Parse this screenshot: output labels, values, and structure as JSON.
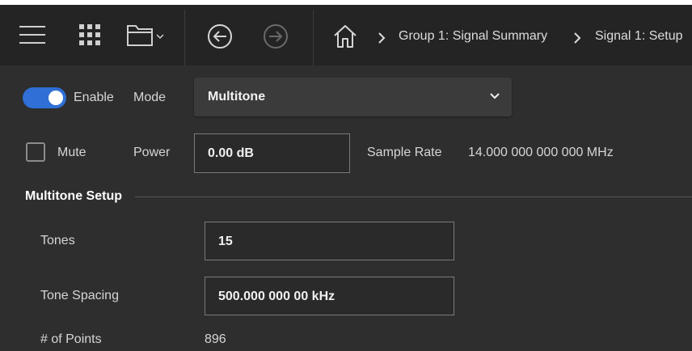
{
  "toolbar": {
    "icons": [
      "menu-icon",
      "apps-grid-icon",
      "folder-icon",
      "back-icon",
      "forward-icon",
      "home-icon"
    ],
    "breadcrumb": [
      {
        "label": "Group 1: Signal Summary"
      },
      {
        "label": "Signal 1: Setup"
      }
    ]
  },
  "signal": {
    "enable_label": "Enable",
    "enable_on": true,
    "mode_label": "Mode",
    "mode_value": "Multitone",
    "mute_label": "Mute",
    "mute_checked": false,
    "power_label": "Power",
    "power_value": "0.00 dB",
    "sample_rate_label": "Sample Rate",
    "sample_rate_value": "14.000 000 000 000 MHz"
  },
  "multitone": {
    "section_title": "Multitone Setup",
    "tones_label": "Tones",
    "tones_value": "15",
    "spacing_label": "Tone Spacing",
    "spacing_value": "500.000 000 00 kHz",
    "points_label": "# of Points",
    "points_value": "896"
  },
  "colors": {
    "accent": "#2f6fd6",
    "background": "#2e2e2e",
    "toolbar": "#242424"
  }
}
